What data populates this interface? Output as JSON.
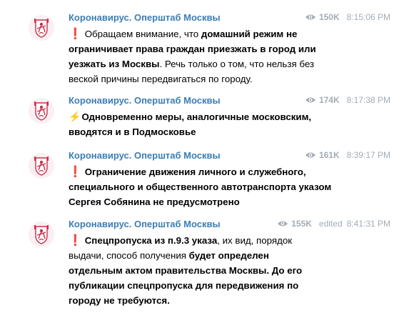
{
  "channel": {
    "name": "Коронавирус. Оперштаб Москвы"
  },
  "icons": {
    "avatar": "moscow-coat-of-arms-icon",
    "views": "eye-icon",
    "exclamation": "red-exclamation-icon",
    "lightning": "lightning-icon"
  },
  "colors": {
    "author": "#3a7eb5",
    "meta": "#a3acb4",
    "exclamation": "#d32028",
    "lightning": "#f2b21b"
  },
  "messages": [
    {
      "views": "150K",
      "time": "8:15:06 PM",
      "edited": "",
      "lines": [
        {
          "emoji": "❗",
          "p1": "Обращаем внимание, что ",
          "b1": "домашний режим не",
          "p2": ""
        },
        {
          "emoji": "",
          "p1": "",
          "b1": "ограничивает права граждан приезжать в город или",
          "p2": ""
        },
        {
          "emoji": "",
          "p1": "",
          "b1": "уезжать из Москвы",
          "p2": ". Речь только о том, что нельзя без"
        },
        {
          "emoji": "",
          "p1": "веской причины передвигаться по городу.",
          "b1": "",
          "p2": ""
        }
      ]
    },
    {
      "views": "174K",
      "time": "8:17:38 PM",
      "edited": "",
      "lines": [
        {
          "emoji": "⚡",
          "p1": "",
          "b1": "Одновременно меры, аналогичные московским,",
          "p2": ""
        },
        {
          "emoji": "",
          "p1": "",
          "b1": "вводятся и в Подмосковье",
          "p2": ""
        }
      ]
    },
    {
      "views": "161K",
      "time": "8:39:17 PM",
      "edited": "",
      "lines": [
        {
          "emoji": "❗",
          "p1": "",
          "b1": "Ограничение движения личного и служебного,",
          "p2": ""
        },
        {
          "emoji": "",
          "p1": "",
          "b1": "специального и общественного автотранспорта указом",
          "p2": ""
        },
        {
          "emoji": "",
          "p1": "",
          "b1": "Сергея Собянина не предусмотрено",
          "p2": ""
        }
      ]
    },
    {
      "views": "155K",
      "time": "8:41:31 PM",
      "edited": "edited",
      "lines": [
        {
          "emoji": "❗",
          "p1": "",
          "b1": "Спецпропуска из п.9.3 указа",
          "p2": ", их вид, порядок"
        },
        {
          "emoji": "",
          "p1": "выдачи, способ получения ",
          "b1": "будет определен",
          "p2": ""
        },
        {
          "emoji": "",
          "p1": "",
          "b1": "отдельным актом правительства Москвы. До его",
          "p2": ""
        },
        {
          "emoji": "",
          "p1": "",
          "b1": "публикации спецпропуска для передвижения по",
          "p2": ""
        },
        {
          "emoji": "",
          "p1": "",
          "b1": "городу не требуются.",
          "p2": ""
        }
      ]
    }
  ]
}
